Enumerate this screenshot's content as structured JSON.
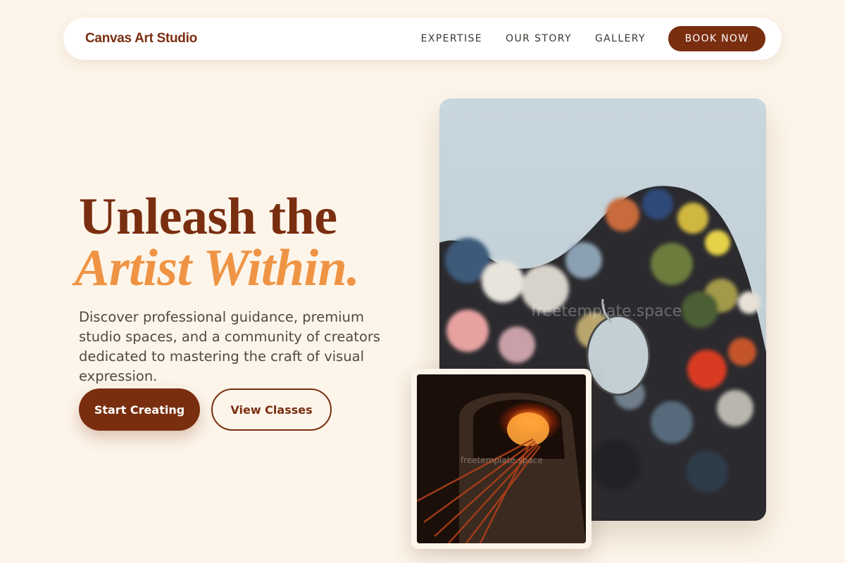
{
  "header": {
    "brand": "Canvas Art Studio",
    "nav": [
      {
        "label": "EXPERTISE"
      },
      {
        "label": "OUR STORY"
      },
      {
        "label": "GALLERY"
      }
    ],
    "cta_label": "BOOK NOW"
  },
  "hero": {
    "title_line1": "Unleash the",
    "title_line2": "Artist Within.",
    "description": "Discover professional guidance, premium studio spaces, and a community of creators dedicated to mastering the craft of visual expression.",
    "primary_button": "Start Creating",
    "secondary_button": "View Classes"
  },
  "images": {
    "main_watermark": "freetemplate.space",
    "small_watermark": "freetemplate.space"
  },
  "colors": {
    "background": "#fdf5ea",
    "brand": "#7a2e10",
    "accent": "#ef9444",
    "text": "#4f4944"
  }
}
